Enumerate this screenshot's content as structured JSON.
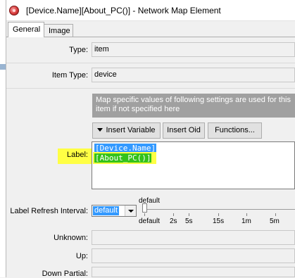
{
  "window": {
    "title": "[Device.Name][About_PC()] - Network Map Element"
  },
  "tabs": [
    {
      "label": "General",
      "active": true
    },
    {
      "label": "Image",
      "active": false
    }
  ],
  "form": {
    "type_label": "Type:",
    "type_value": "item",
    "item_type_label": "Item Type:",
    "item_type_value": "device",
    "info_text": "Map specific values of following settings are used for this item if not specified here",
    "insert_variable_label": "Insert Variable",
    "insert_oid_label": "Insert Oid",
    "functions_label": "Functions...",
    "label_label": "Label:",
    "label_lines": [
      "[Device.Name]",
      "[About_PC()]"
    ],
    "refresh_label": "Label Refresh Interval:",
    "refresh_value": "default",
    "slider_current": "default",
    "slider_ticks": [
      "default",
      "2s",
      "5s",
      "15s",
      "1m",
      "5m"
    ],
    "unknown_label": "Unknown:",
    "up_label": "Up:",
    "down_partial_label": "Down Partial:"
  },
  "colors": {
    "selection": "#3399ff",
    "highlight_line": "#34c21a",
    "marker": "#ffff44",
    "info_box": "#a0a0a0"
  },
  "icons": {
    "app": "network-map-element-icon",
    "dropdown": "triangle-down-icon"
  }
}
